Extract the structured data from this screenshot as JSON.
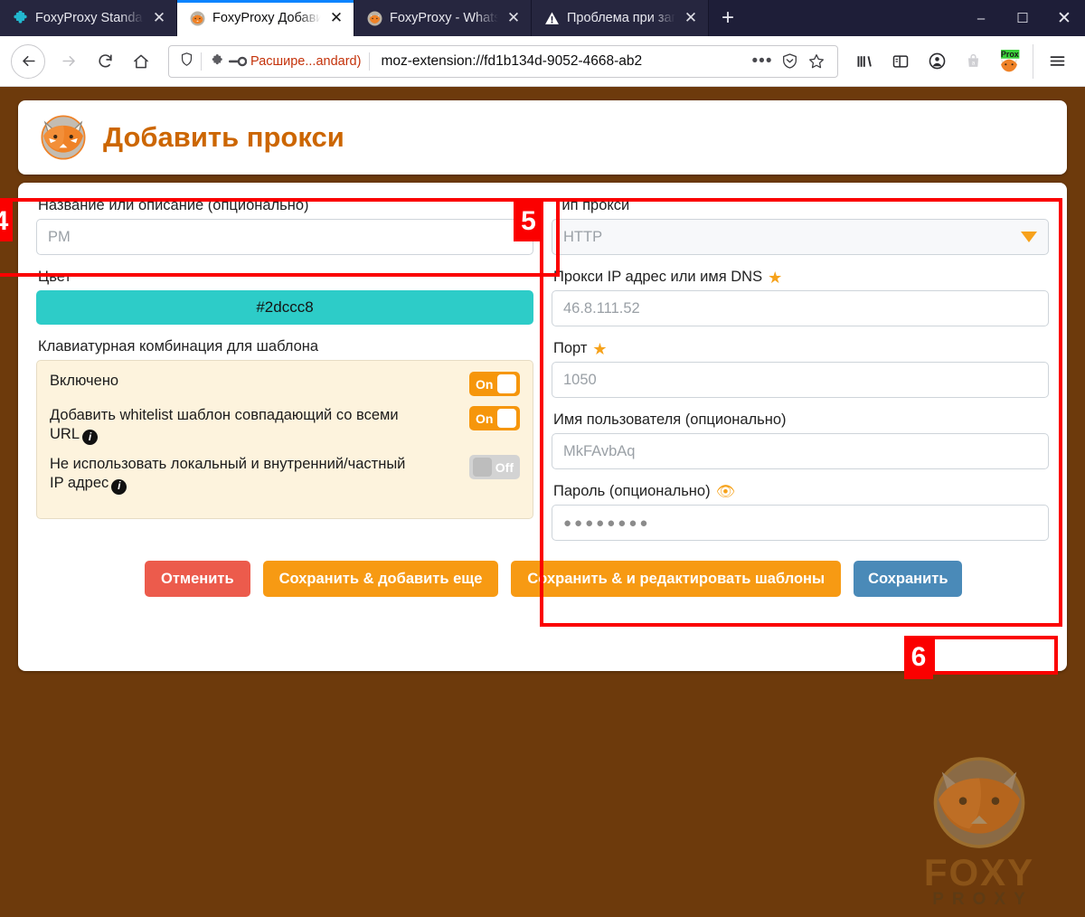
{
  "browser": {
    "tabs": [
      {
        "title": "FoxyProxy Standard – ",
        "icon": "puzzle-icon",
        "active": false
      },
      {
        "title": "FoxyProxy Добавить п",
        "icon": "foxyproxy-icon",
        "active": true
      },
      {
        "title": "FoxyProxy - Whats My ",
        "icon": "foxyproxy-icon",
        "active": false
      },
      {
        "title": "Проблема при загруз",
        "icon": "warning-icon",
        "active": false
      }
    ],
    "new_tab_label": "+",
    "window_controls": {
      "minimize": "–",
      "maximize": "☐",
      "close": "✕"
    },
    "url_bar": {
      "extension_chip": "Расшире...andard)",
      "url": "moz-extension://fd1b134d-9052-4668-ab2",
      "page_actions_label": "•••"
    },
    "toolbar_icons": [
      "library-icon",
      "sidebar-icon",
      "account-icon",
      "shopping-bag-icon",
      "foxyproxy-toolbar-icon",
      "menu-icon"
    ],
    "proxy_badge_label": "Prox"
  },
  "header": {
    "title": "Добавить прокси",
    "logo": "foxyproxy-logo",
    "accent_color": "#cc6600"
  },
  "left_column": {
    "title_label": "Название или описание (опционально)",
    "title_value": "PM",
    "color_label": "Цвет",
    "color_value": "#2dccc8",
    "shortcut_label": "Клавиатурная комбинация для шаблона",
    "toggles": [
      {
        "label": "Включено",
        "state": "On",
        "info": false
      },
      {
        "label": "Добавить whitelist шаблон совпадающий со всеми URL",
        "state": "On",
        "info": true
      },
      {
        "label": "Не использовать локальный и внутренний/частный IP адрес",
        "state": "Off",
        "info": true
      }
    ]
  },
  "right_column": {
    "proxy_type_label": "Тип прокси",
    "proxy_type_value": "HTTP",
    "proxy_type_options": [
      "HTTP"
    ],
    "host_label": "Прокси IP адрес или имя DNS",
    "host_value": "46.8.111.52",
    "port_label": "Порт",
    "port_value": "1050",
    "username_label": "Имя пользователя (опционально)",
    "username_value": "MkFAvbAq",
    "password_label": "Пароль (опционально)",
    "password_value": "●●●●●●●●"
  },
  "buttons": {
    "cancel": "Отменить",
    "save_add_more": "Сохранить & добавить еще",
    "save_edit_patterns": "Сохранить & и редактировать шаблоны",
    "save": "Сохранить"
  },
  "annotations": {
    "badge_4": "4",
    "badge_5": "5",
    "badge_6": "6",
    "color": "#fb0000"
  },
  "watermark": {
    "line1": "FOXY",
    "line2": "PROXY"
  }
}
